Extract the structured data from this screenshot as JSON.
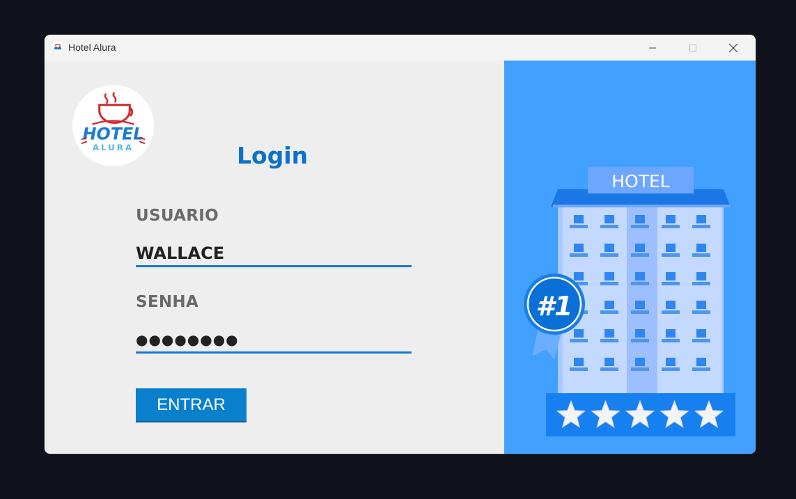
{
  "window": {
    "title": "Hotel Alura",
    "controls": {
      "minimize": "minimize",
      "maximize": "maximize",
      "close": "close"
    }
  },
  "logo": {
    "word_top": "HOTEL",
    "word_bottom": "ALURA"
  },
  "login": {
    "title": "Login",
    "user_label": "USUARIO",
    "user_value": "WALLACE",
    "password_label": "SENHA",
    "password_value": "●●●●●●●●",
    "submit_label": "ENTRAR"
  },
  "illustration": {
    "sign_text": "HOTEL",
    "badge_text": "#1",
    "stars": 5
  },
  "colors": {
    "accent": "#0b72cc",
    "button": "#0a80cc",
    "right_panel": "#42a0ff",
    "underline": "#1577d1"
  }
}
